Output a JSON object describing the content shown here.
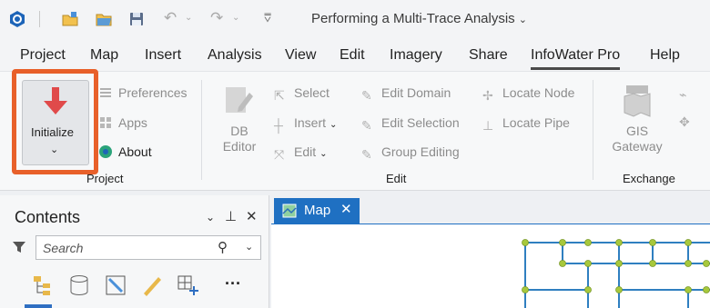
{
  "window": {
    "title": "Performing a Multi-Trace Analysis",
    "title_chevron": "⌄"
  },
  "menu": {
    "tabs": [
      {
        "label": "Project"
      },
      {
        "label": "Map"
      },
      {
        "label": "Insert"
      },
      {
        "label": "Analysis"
      },
      {
        "label": "View"
      },
      {
        "label": "Edit"
      },
      {
        "label": "Imagery"
      },
      {
        "label": "Share"
      },
      {
        "label": "InfoWater Pro",
        "active": true
      },
      {
        "label": "Help"
      }
    ]
  },
  "ribbon": {
    "project_group": {
      "label": "Project",
      "initialize": "Initialize",
      "preferences": "Preferences",
      "apps": "Apps",
      "about": "About"
    },
    "edit_group": {
      "label": "Edit",
      "db_editor_line1": "DB",
      "db_editor_line2": "Editor",
      "select": "Select",
      "insert": "Insert",
      "edit": "Edit",
      "edit_domain": "Edit Domain",
      "edit_selection": "Edit Selection",
      "group_editing": "Group Editing",
      "locate_node": "Locate Node",
      "locate_pipe": "Locate Pipe"
    },
    "exchange_group": {
      "label": "Exchange",
      "gis_gateway_line1": "GIS",
      "gis_gateway_line2": "Gateway"
    }
  },
  "contents": {
    "title": "Contents",
    "search_placeholder": "Search"
  },
  "map": {
    "tab_label": "Map"
  },
  "colors": {
    "accent": "#1f70c2",
    "highlight": "#e8602a",
    "network_pipe": "#2f7fc0",
    "network_node": "#a7c83c"
  }
}
